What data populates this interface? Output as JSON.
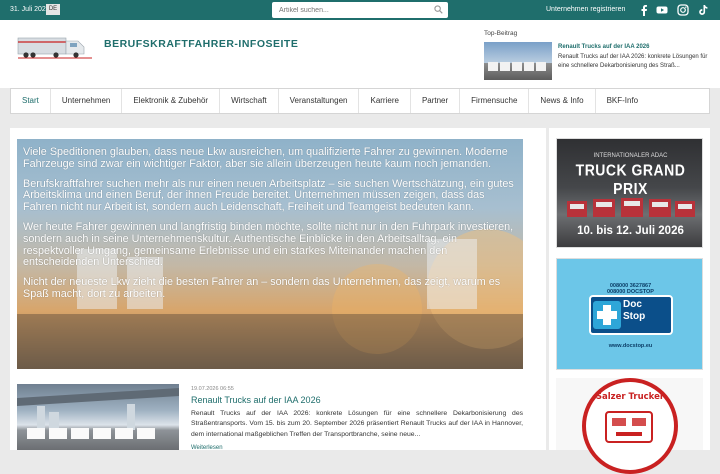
{
  "topbar": {
    "date": "31. Juli 2026",
    "language": "DE",
    "search_placeholder": "Artikel suchen...",
    "register_link": "Unternehmen registrieren",
    "social_icons": [
      "facebook-icon",
      "youtube-icon",
      "instagram-icon",
      "tiktok-icon"
    ]
  },
  "header": {
    "site_name": "BERUFSKRAFTFAHRER-INFOSEITE",
    "top_label": "Top-Beitrag",
    "top_title": "Renault Trucks auf der IAA 2026",
    "top_text": "Renault Trucks auf der IAA 2026: konkrete Lösungen für eine schnellere Dekarbonisierung des Straß..."
  },
  "nav": {
    "items": [
      "Start",
      "Unternehmen",
      "Elektronik & Zubehör",
      "Wirtschaft",
      "Veranstaltungen",
      "Karriere",
      "Partner",
      "Firmensuche",
      "News & Info",
      "BKF-Info"
    ],
    "active": "Start"
  },
  "hero": {
    "paragraphs": [
      "Viele Speditionen glauben, dass neue Lkw ausreichen, um qualifizierte Fahrer zu gewinnen. Moderne Fahrzeuge sind zwar ein wichtiger Faktor, aber sie allein überzeugen heute kaum noch jemanden.",
      "Berufskraftfahrer suchen mehr als nur einen neuen Arbeitsplatz – sie suchen Wertschätzung, ein gutes Arbeitsklima und einen Beruf, der ihnen Freude bereitet. Unternehmen müssen zeigen, dass das Fahren nicht nur Arbeit ist, sondern auch Leidenschaft, Freiheit und Teamgeist bedeuten kann.",
      "Wer heute Fahrer gewinnen und langfristig binden möchte, sollte nicht nur in den Fuhrpark investieren, sondern auch in seine Unternehmenskultur. Authentische Einblicke in den Arbeitsalltag, ein respektvoller Umgang, gemeinsame Erlebnisse und ein starkes Miteinander machen den entscheidenden Unterschied.",
      "Nicht der neueste Lkw zieht die besten Fahrer an – sondern das Unternehmen, das zeigt, warum es Spaß macht, dort zu arbeiten."
    ]
  },
  "article": {
    "date": "19.07.2026 06:55",
    "title": "Renault Trucks auf der IAA 2026",
    "text": "Renault Trucks auf der IAA 2026: konkrete Lösungen für eine schnellere Dekarbonisierung des Straßentransports. Vom 15. bis zum 20. September 2026 präsentiert Renault Trucks auf der IAA in Hannover, dem international maßgeblichen Treffen der Transportbranche, seine neue...",
    "more": "Weiterlesen"
  },
  "sidebar": {
    "ad1": {
      "line1": "INTERNATIONALER ADAC",
      "line2": "TRUCK GRAND PRIX",
      "line3": "10. bis 12. Juli 2026"
    },
    "ad2": {
      "phone1": "008000 3627867",
      "phone2": "008000 DOCSTOP",
      "brand_line1": "Doc",
      "brand_line2": "Stop",
      "url": "www.docstop.eu"
    },
    "ad3": {
      "title": "Salzer Trucker"
    }
  },
  "colors": {
    "brand": "#1f6e6c",
    "accent_red": "#c92121"
  }
}
